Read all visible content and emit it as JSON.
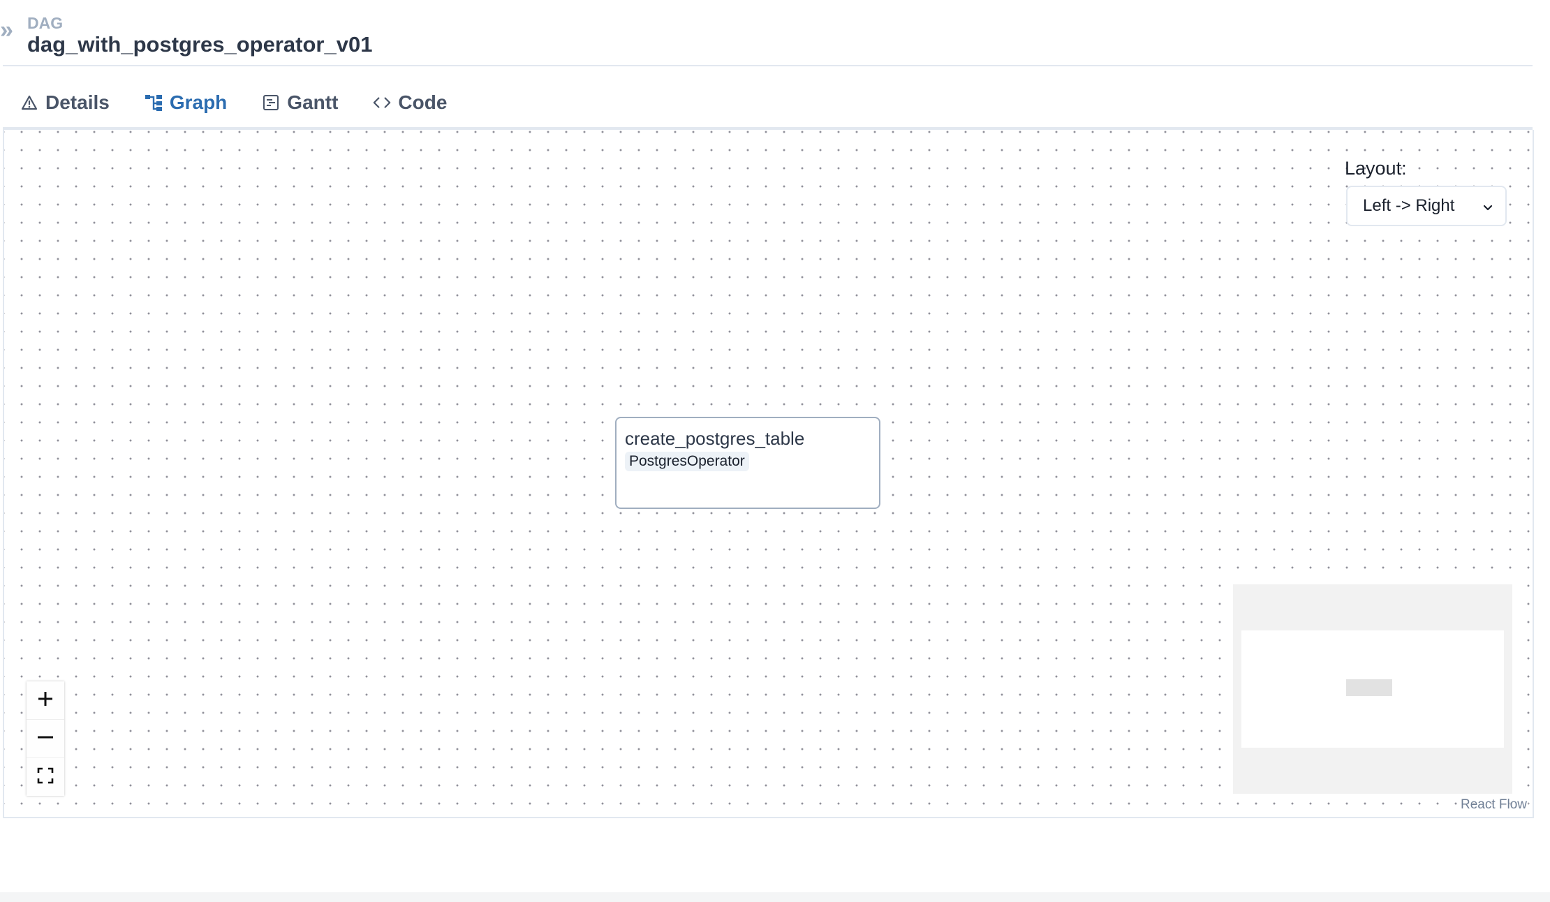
{
  "header": {
    "collapse_icon": "double-chevron-right-icon",
    "breadcrumb_label": "DAG",
    "dag_id": "dag_with_postgres_operator_v01"
  },
  "tabs": [
    {
      "label": "Details",
      "icon": "warning-triangle-icon",
      "active": false
    },
    {
      "label": "Graph",
      "icon": "graph-icon",
      "active": true
    },
    {
      "label": "Gantt",
      "icon": "gantt-icon",
      "active": false
    },
    {
      "label": "Code",
      "icon": "code-brackets-icon",
      "active": false
    }
  ],
  "graph": {
    "layout_label": "Layout:",
    "layout_selected": "Left -> Right",
    "nodes": [
      {
        "task_id": "create_postgres_table",
        "operator": "PostgresOperator"
      }
    ],
    "controls": {
      "zoom_in_icon": "plus-icon",
      "zoom_out_icon": "minus-icon",
      "fit_view_icon": "fit-view-icon"
    },
    "attribution": "React Flow"
  },
  "colors": {
    "accent": "#2b6cb0",
    "muted": "#a0aec0",
    "border": "#e2e8f0"
  }
}
